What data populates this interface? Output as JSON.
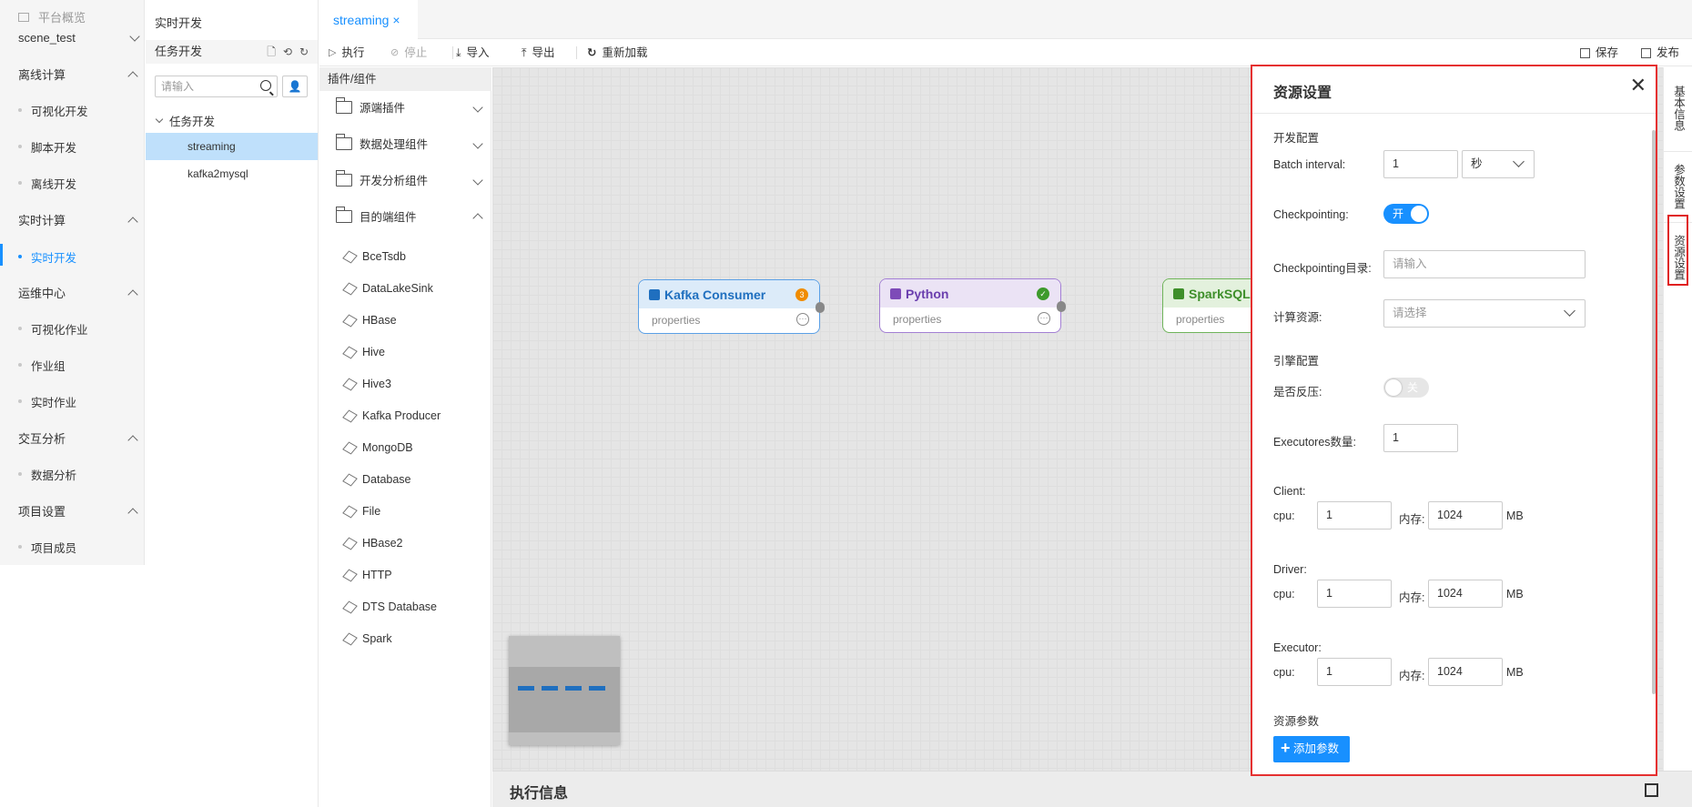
{
  "nav": {
    "overview": "平台概览",
    "project": "scene_test",
    "sections": [
      {
        "label": "离线计算",
        "items": [
          "可视化开发",
          "脚本开发",
          "离线开发"
        ]
      },
      {
        "label": "实时计算",
        "items": [
          "实时开发"
        ]
      },
      {
        "label": "运维中心",
        "items": [
          "可视化作业",
          "作业组",
          "实时作业"
        ]
      },
      {
        "label": "交互分析",
        "items": [
          "数据分析"
        ]
      },
      {
        "label": "项目设置",
        "items": [
          "项目成员"
        ]
      }
    ]
  },
  "task_panel": {
    "title": "实时开发",
    "section": "任务开发",
    "search_placeholder": "请输入",
    "tree_root": "任务开发",
    "tasks": [
      "streaming",
      "kafka2mysql"
    ]
  },
  "tab": {
    "label": "streaming",
    "close": "×"
  },
  "toolbar": {
    "run": "执行",
    "stop": "停止",
    "import": "导入",
    "export": "导出",
    "reload": "重新加载",
    "save": "保存",
    "publish": "发布"
  },
  "plugins": {
    "header": "插件/组件",
    "groups": [
      "源端插件",
      "数据处理组件",
      "开发分析组件",
      "目的端组件"
    ],
    "items": [
      "BceTsdb",
      "DataLakeSink",
      "HBase",
      "Hive",
      "Hive3",
      "Kafka Producer",
      "MongoDB",
      "Database",
      "File",
      "HBase2",
      "HTTP",
      "DTS Database",
      "Spark"
    ]
  },
  "canvas": {
    "nodes": [
      {
        "title": "Kafka Consumer",
        "sub": "properties",
        "badge": "3",
        "color": "#1f6fbf"
      },
      {
        "title": "Python",
        "sub": "properties",
        "badge": "✓",
        "color": "#7e4bb8"
      },
      {
        "title": "SparkSQL",
        "sub": "properties",
        "color": "#3e8f2a"
      }
    ],
    "exec_title": "执行信息"
  },
  "side_tabs": [
    "基本信息",
    "参数设置",
    "资源设置"
  ],
  "resource": {
    "title": "资源设置",
    "close": "✕",
    "dev_section": "开发配置",
    "batch_label": "Batch interval:",
    "batch_value": "1",
    "batch_unit": "秒",
    "checkpoint_label": "Checkpointing:",
    "checkpoint_toggle": "开",
    "checkpoint_dir_label": "Checkpointing目录:",
    "checkpoint_dir_placeholder": "请输入",
    "compute_label": "计算资源:",
    "compute_placeholder": "请选择",
    "engine_section": "引擎配置",
    "backpressure_label": "是否反压:",
    "backpressure_toggle": "关",
    "executors_label": "Executores数量:",
    "executors_value": "1",
    "client_label": "Client:",
    "driver_label": "Driver:",
    "executor_label": "Executor:",
    "cpu_label": "cpu:",
    "mem_label": "内存:",
    "mb": "MB",
    "client": {
      "cpu": "1",
      "mem": "1024"
    },
    "driver": {
      "cpu": "1",
      "mem": "1024"
    },
    "executor": {
      "cpu": "1",
      "mem": "1024"
    },
    "params_section": "资源参数",
    "add_param": "添加参数"
  }
}
